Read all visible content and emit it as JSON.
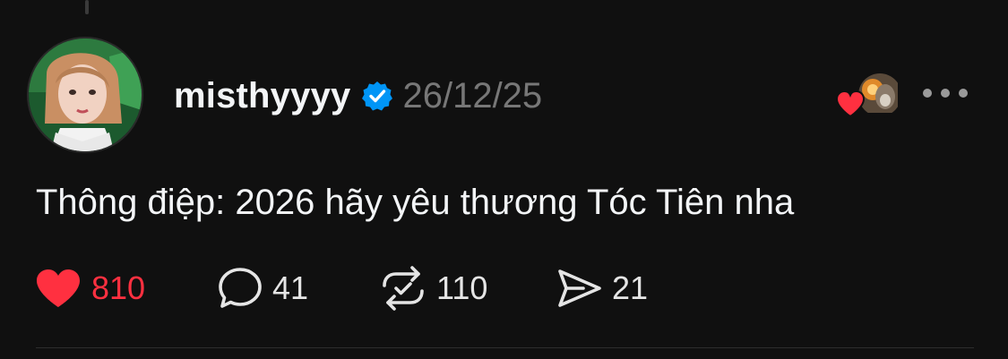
{
  "post": {
    "username": "misthyyyy",
    "verified_icon": "verified-badge-icon",
    "timestamp": "26/12/25",
    "text": "Thông điệp: 2026 hãy yêu thương Tóc Tiên nha",
    "liked": true
  },
  "actions": {
    "likes": "810",
    "replies": "41",
    "reposts": "110",
    "shares": "21"
  },
  "colors": {
    "background": "#101010",
    "like_red": "#ff3040",
    "verified_blue": "#0095f6",
    "muted_gray": "#777777"
  },
  "icons": [
    "heart-icon",
    "comment-icon",
    "repost-icon",
    "share-icon",
    "more-icon"
  ]
}
